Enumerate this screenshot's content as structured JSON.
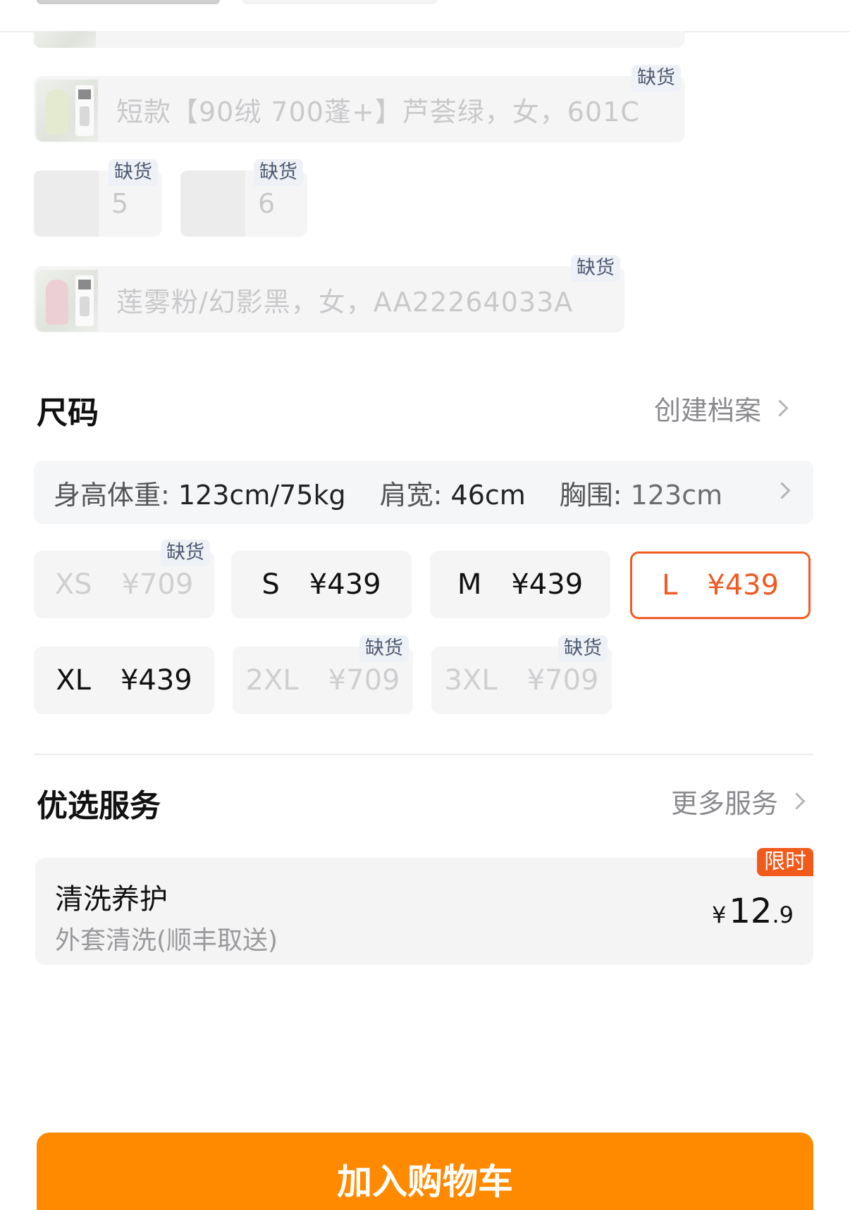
{
  "colors": {
    "accent": "#f25a23",
    "cart_button": "#ff8a00",
    "limited_badge": "#f25a1c",
    "chip_bg": "#f5f5f6"
  },
  "color_options": {
    "items": [
      {
        "label": "短款【90绒 700蓬+】芦荟绿，女，601C",
        "stock": "缺货"
      },
      {
        "label": "5",
        "stock": "缺货"
      },
      {
        "label": "6",
        "stock": "缺货"
      },
      {
        "label": "莲雾粉/幻影黑，女，AA22264033A",
        "stock": "缺货"
      }
    ]
  },
  "size": {
    "title": "尺码",
    "create_profile": "创建档案",
    "profile": {
      "height_weight_label": "身高体重: ",
      "height_weight_value": "123cm/75kg",
      "shoulder_label": "肩宽: ",
      "shoulder_value": "46cm",
      "chest_label": "胸围: ",
      "chest_value": "123cm"
    },
    "options": [
      {
        "size": "XS",
        "price": "¥709",
        "stock": "缺货"
      },
      {
        "size": "S",
        "price": "¥439"
      },
      {
        "size": "M",
        "price": "¥439"
      },
      {
        "size": "L",
        "price": "¥439",
        "selected": true
      },
      {
        "size": "XL",
        "price": "¥439"
      },
      {
        "size": "2XL",
        "price": "¥709",
        "stock": "缺货"
      },
      {
        "size": "3XL",
        "price": "¥709",
        "stock": "缺货"
      }
    ]
  },
  "services": {
    "title": "优选服务",
    "more": "更多服务",
    "card": {
      "name": "清洗养护",
      "description": "外套清洗(顺丰取送)",
      "badge": "限时",
      "price_currency": "¥",
      "price_int": "12",
      "price_decimal": ".9"
    }
  },
  "cart_button": "加入购物车"
}
